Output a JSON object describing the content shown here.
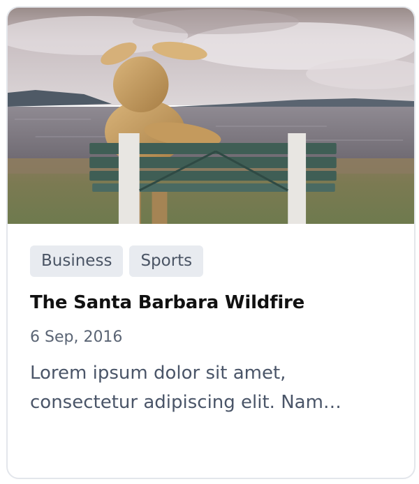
{
  "card": {
    "tags": [
      "Business",
      "Sports"
    ],
    "title": "The Santa Barbara Wildfire",
    "date": "6 Sep, 2016",
    "excerpt": "Lorem ipsum dolor sit amet, consectetur adipiscing elit. Nam…"
  },
  "colors": {
    "border": "#e3e6eb",
    "tag_bg": "#e8ebf0",
    "tag_text": "#4a5464",
    "title": "#111111",
    "date": "#5a6474",
    "excerpt": "#4a5568"
  }
}
